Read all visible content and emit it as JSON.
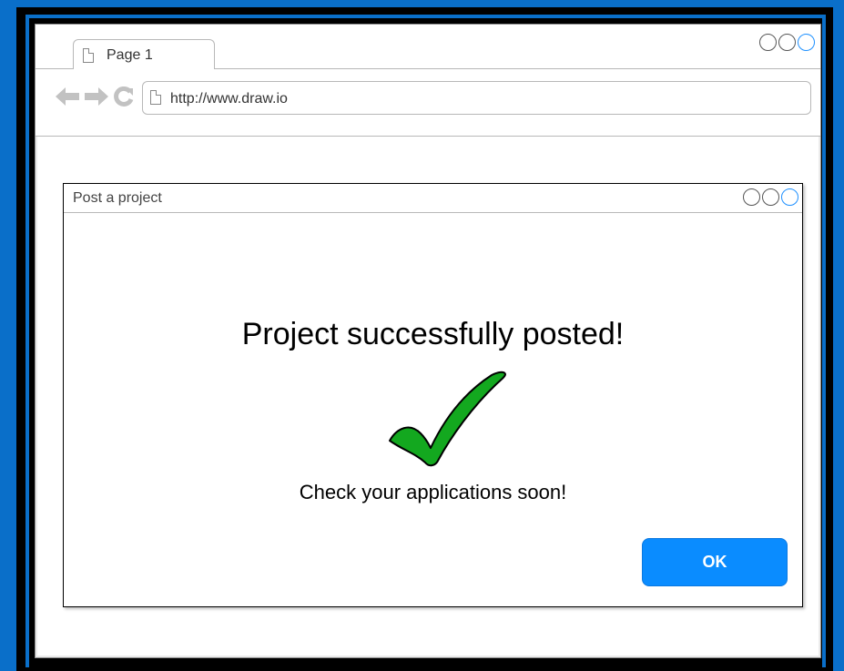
{
  "browser": {
    "tab_label": "Page 1",
    "url": "http://www.draw.io",
    "nav": {
      "back_icon": "arrow-left-icon",
      "forward_icon": "arrow-right-icon",
      "reload_icon": "reload-icon"
    }
  },
  "dialog": {
    "title": "Post a project",
    "heading": "Project successfully posted!",
    "message": "Check your applications soon!",
    "ok_label": "OK",
    "icon": "checkmark-icon"
  },
  "colors": {
    "background": "#0a6fc9",
    "ok_button": "#0a8cff",
    "checkmark_fill": "#13a81f",
    "control_accent": "#1e90ff"
  }
}
